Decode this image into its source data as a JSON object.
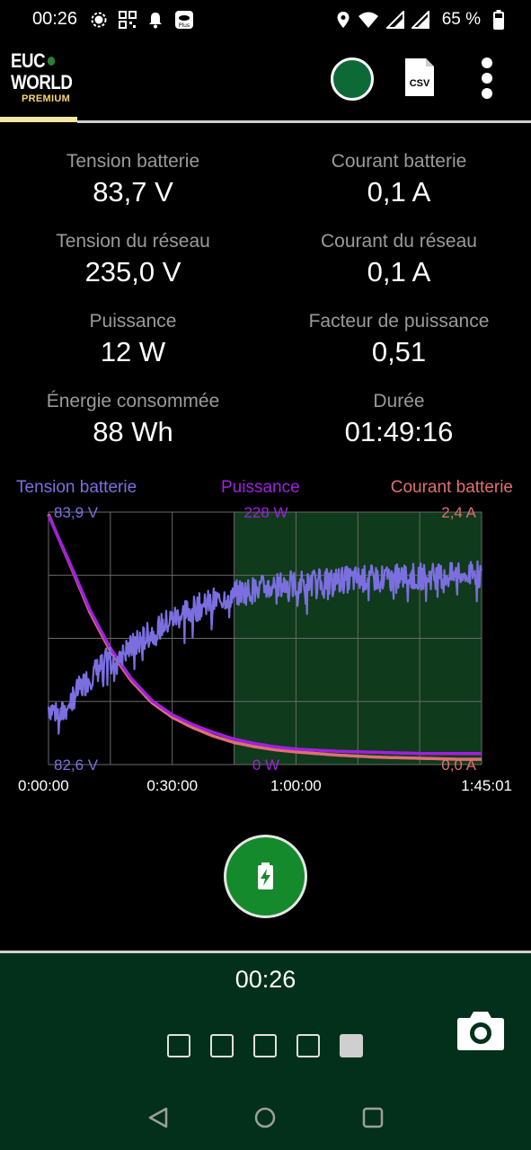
{
  "status_bar": {
    "time": "00:26",
    "battery_percent": "65 %",
    "left_icons": [
      "signal-messenger-icon",
      "qr-code-icon",
      "notification-bell-icon",
      "app-plus-icon"
    ],
    "right_icons": [
      "location-icon",
      "wifi-icon",
      "cell-signal-icon",
      "cell-signal-icon",
      "battery-icon"
    ]
  },
  "app_bar": {
    "logo_line1": "EUC",
    "logo_line2": "WORLD",
    "logo_tier": "PREMIUM",
    "status_color": "#0d6a36",
    "csv_label": "CSV"
  },
  "metrics": [
    {
      "label": "Tension batterie",
      "value": "83,7 V"
    },
    {
      "label": "Courant batterie",
      "value": "0,1 A"
    },
    {
      "label": "Tension du réseau",
      "value": "235,0 V"
    },
    {
      "label": "Courant du réseau",
      "value": "0,1 A"
    },
    {
      "label": "Puissance",
      "value": "12 W"
    },
    {
      "label": "Facteur de puissance",
      "value": "0,51"
    },
    {
      "label": "Énergie consommée",
      "value": "88 Wh"
    },
    {
      "label": "Durée",
      "value": "01:49:16"
    }
  ],
  "chart_data": {
    "type": "line",
    "xlabel": "",
    "x_ticks": [
      "0:00:00",
      "0:30:00",
      "1:00:00",
      "1:45:01"
    ],
    "x_range_seconds": [
      0,
      6301
    ],
    "highlight_region_start_seconds": 2700,
    "grid": true,
    "legend_placement": "top",
    "series": [
      {
        "name": "Tension batterie",
        "color": "#7b6fe0",
        "axis_max_label": "83,9 V",
        "axis_min_label": "82,6 V",
        "ylim": [
          82.6,
          83.9
        ],
        "x_minutes": [
          0,
          3,
          6,
          10,
          15,
          20,
          25,
          30,
          35,
          40,
          45,
          50,
          55,
          60,
          70,
          80,
          90,
          100,
          105
        ],
        "values": [
          82.9,
          82.85,
          82.95,
          83.05,
          83.15,
          83.2,
          83.28,
          83.35,
          83.4,
          83.44,
          83.48,
          83.5,
          83.52,
          83.53,
          83.55,
          83.56,
          83.57,
          83.57,
          83.58
        ]
      },
      {
        "name": "Puissance",
        "color": "#a020e0",
        "axis_max_label": "228 W",
        "axis_min_label": "0 W",
        "ylim": [
          0,
          228
        ],
        "x_minutes": [
          0,
          3,
          6,
          10,
          15,
          20,
          25,
          30,
          35,
          40,
          45,
          50,
          55,
          60,
          70,
          80,
          90,
          100,
          105
        ],
        "values": [
          225,
          200,
          175,
          140,
          105,
          78,
          58,
          45,
          36,
          29,
          23,
          19,
          16,
          14,
          12,
          11,
          10,
          10,
          10
        ]
      },
      {
        "name": "Courant batterie",
        "color": "#e07070",
        "axis_max_label": "2,4 A",
        "axis_min_label": "0,0 A",
        "ylim": [
          0,
          2.4
        ],
        "x_minutes": [
          0,
          3,
          6,
          10,
          15,
          20,
          25,
          30,
          35,
          40,
          45,
          50,
          55,
          60,
          70,
          80,
          90,
          100,
          105
        ],
        "values": [
          2.38,
          2.1,
          1.83,
          1.45,
          1.08,
          0.8,
          0.59,
          0.45,
          0.35,
          0.27,
          0.21,
          0.17,
          0.14,
          0.12,
          0.09,
          0.07,
          0.06,
          0.05,
          0.05
        ]
      }
    ]
  },
  "bottom_panel": {
    "time": "00:26",
    "pages": [
      false,
      false,
      false,
      false,
      true
    ],
    "camera_icon": "camera-icon"
  },
  "navbar": {
    "icons": [
      "back-icon",
      "home-icon",
      "recents-icon"
    ]
  }
}
